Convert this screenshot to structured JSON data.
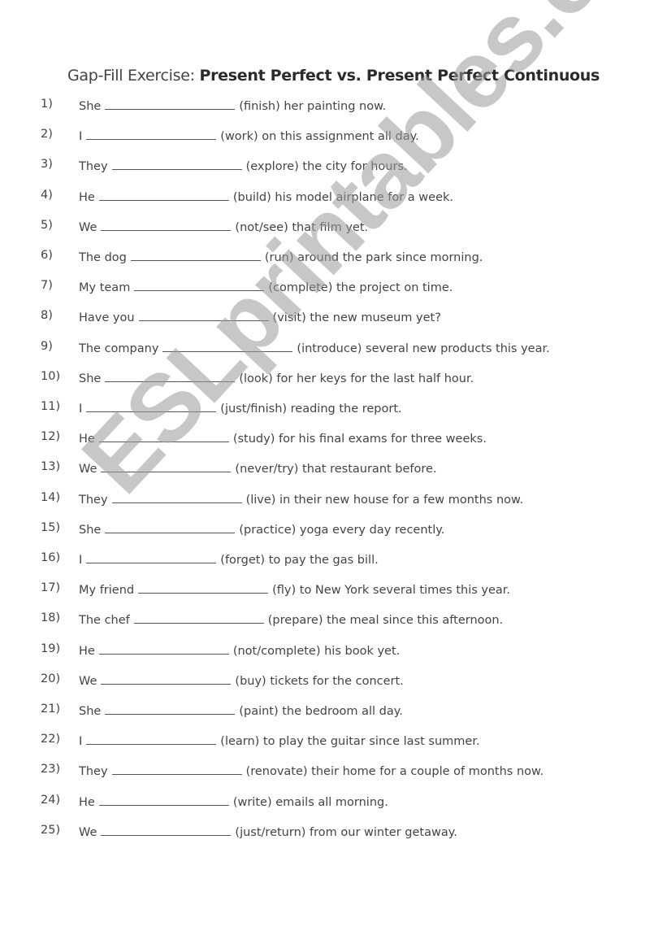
{
  "title": {
    "part1": "Gap-Fill Exercise: ",
    "part2": "Present Perfect vs. Present Perfect Continuous"
  },
  "watermark": "ESLprintables.com",
  "items": [
    {
      "num": "1)",
      "subject": "She",
      "rest": "(finish) her painting now."
    },
    {
      "num": "2)",
      "subject": "I",
      "rest": "(work) on this assignment all day."
    },
    {
      "num": "3)",
      "subject": "They",
      "rest": "(explore) the city for hours."
    },
    {
      "num": "4)",
      "subject": "He",
      "rest": "(build) his model airplane for a week."
    },
    {
      "num": "5)",
      "subject": "We",
      "rest": "(not/see) that film yet."
    },
    {
      "num": "6)",
      "subject": "The dog",
      "rest": "(run) around the park since morning."
    },
    {
      "num": "7)",
      "subject": "My team",
      "rest": "(complete) the project on time."
    },
    {
      "num": "8)",
      "subject": "Have you",
      "rest": "(visit) the new museum yet?"
    },
    {
      "num": "9)",
      "subject": "The company",
      "rest": "(introduce) several new products this year."
    },
    {
      "num": "10)",
      "subject": "She",
      "rest": "(look) for her keys for the last half hour."
    },
    {
      "num": "11)",
      "subject": "I",
      "rest": "(just/finish) reading the report."
    },
    {
      "num": "12)",
      "subject": "He",
      "rest": "(study) for his final exams for three weeks."
    },
    {
      "num": "13)",
      "subject": "We",
      "rest": "(never/try) that restaurant before."
    },
    {
      "num": "14)",
      "subject": "They",
      "rest": "(live) in their new house for a few months now."
    },
    {
      "num": "15)",
      "subject": "She",
      "rest": "(practice) yoga every day recently."
    },
    {
      "num": "16)",
      "subject": "I",
      "rest": "(forget) to pay the gas bill."
    },
    {
      "num": "17)",
      "subject": "My friend",
      "rest": "(fly) to New York several times this year."
    },
    {
      "num": "18)",
      "subject": "The chef",
      "rest": "(prepare) the meal since this afternoon."
    },
    {
      "num": "19)",
      "subject": "He",
      "rest": "(not/complete) his book yet."
    },
    {
      "num": "20)",
      "subject": "We",
      "rest": "(buy) tickets for the concert."
    },
    {
      "num": "21)",
      "subject": "She",
      "rest": "(paint) the bedroom all day."
    },
    {
      "num": "22)",
      "subject": "I",
      "rest": "(learn) to play the guitar since last summer."
    },
    {
      "num": "23)",
      "subject": "They",
      "rest": "(renovate) their home for a couple of months now."
    },
    {
      "num": "24)",
      "subject": "He",
      "rest": "(write) emails all morning."
    },
    {
      "num": "25)",
      "subject": "We",
      "rest": "(just/return) from our winter getaway."
    }
  ]
}
